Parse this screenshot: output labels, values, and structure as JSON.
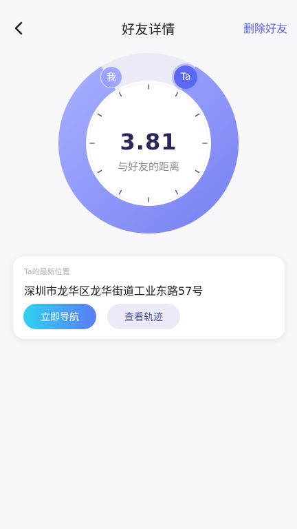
{
  "header": {
    "title": "好友详情",
    "delete_label": "删除好友",
    "back_icon": "chevron-left-icon"
  },
  "distance": {
    "value": "3.81",
    "label": "与好友的距离"
  },
  "avatars": {
    "me": "我",
    "ta": "Ta"
  },
  "location_card": {
    "label": "Ta的最新位置",
    "address": "深圳市龙华区龙华街道工业东路57号",
    "nav_button": "立即导航",
    "track_button": "查看轨迹"
  },
  "colors": {
    "accent": "#5b63e8",
    "ring_start": "#9ea8ff",
    "ring_end": "#7b85f4",
    "ring_track": "#ebebf8",
    "nav_gradient_start": "#2fd3ef",
    "nav_gradient_end": "#5b7cf5"
  }
}
